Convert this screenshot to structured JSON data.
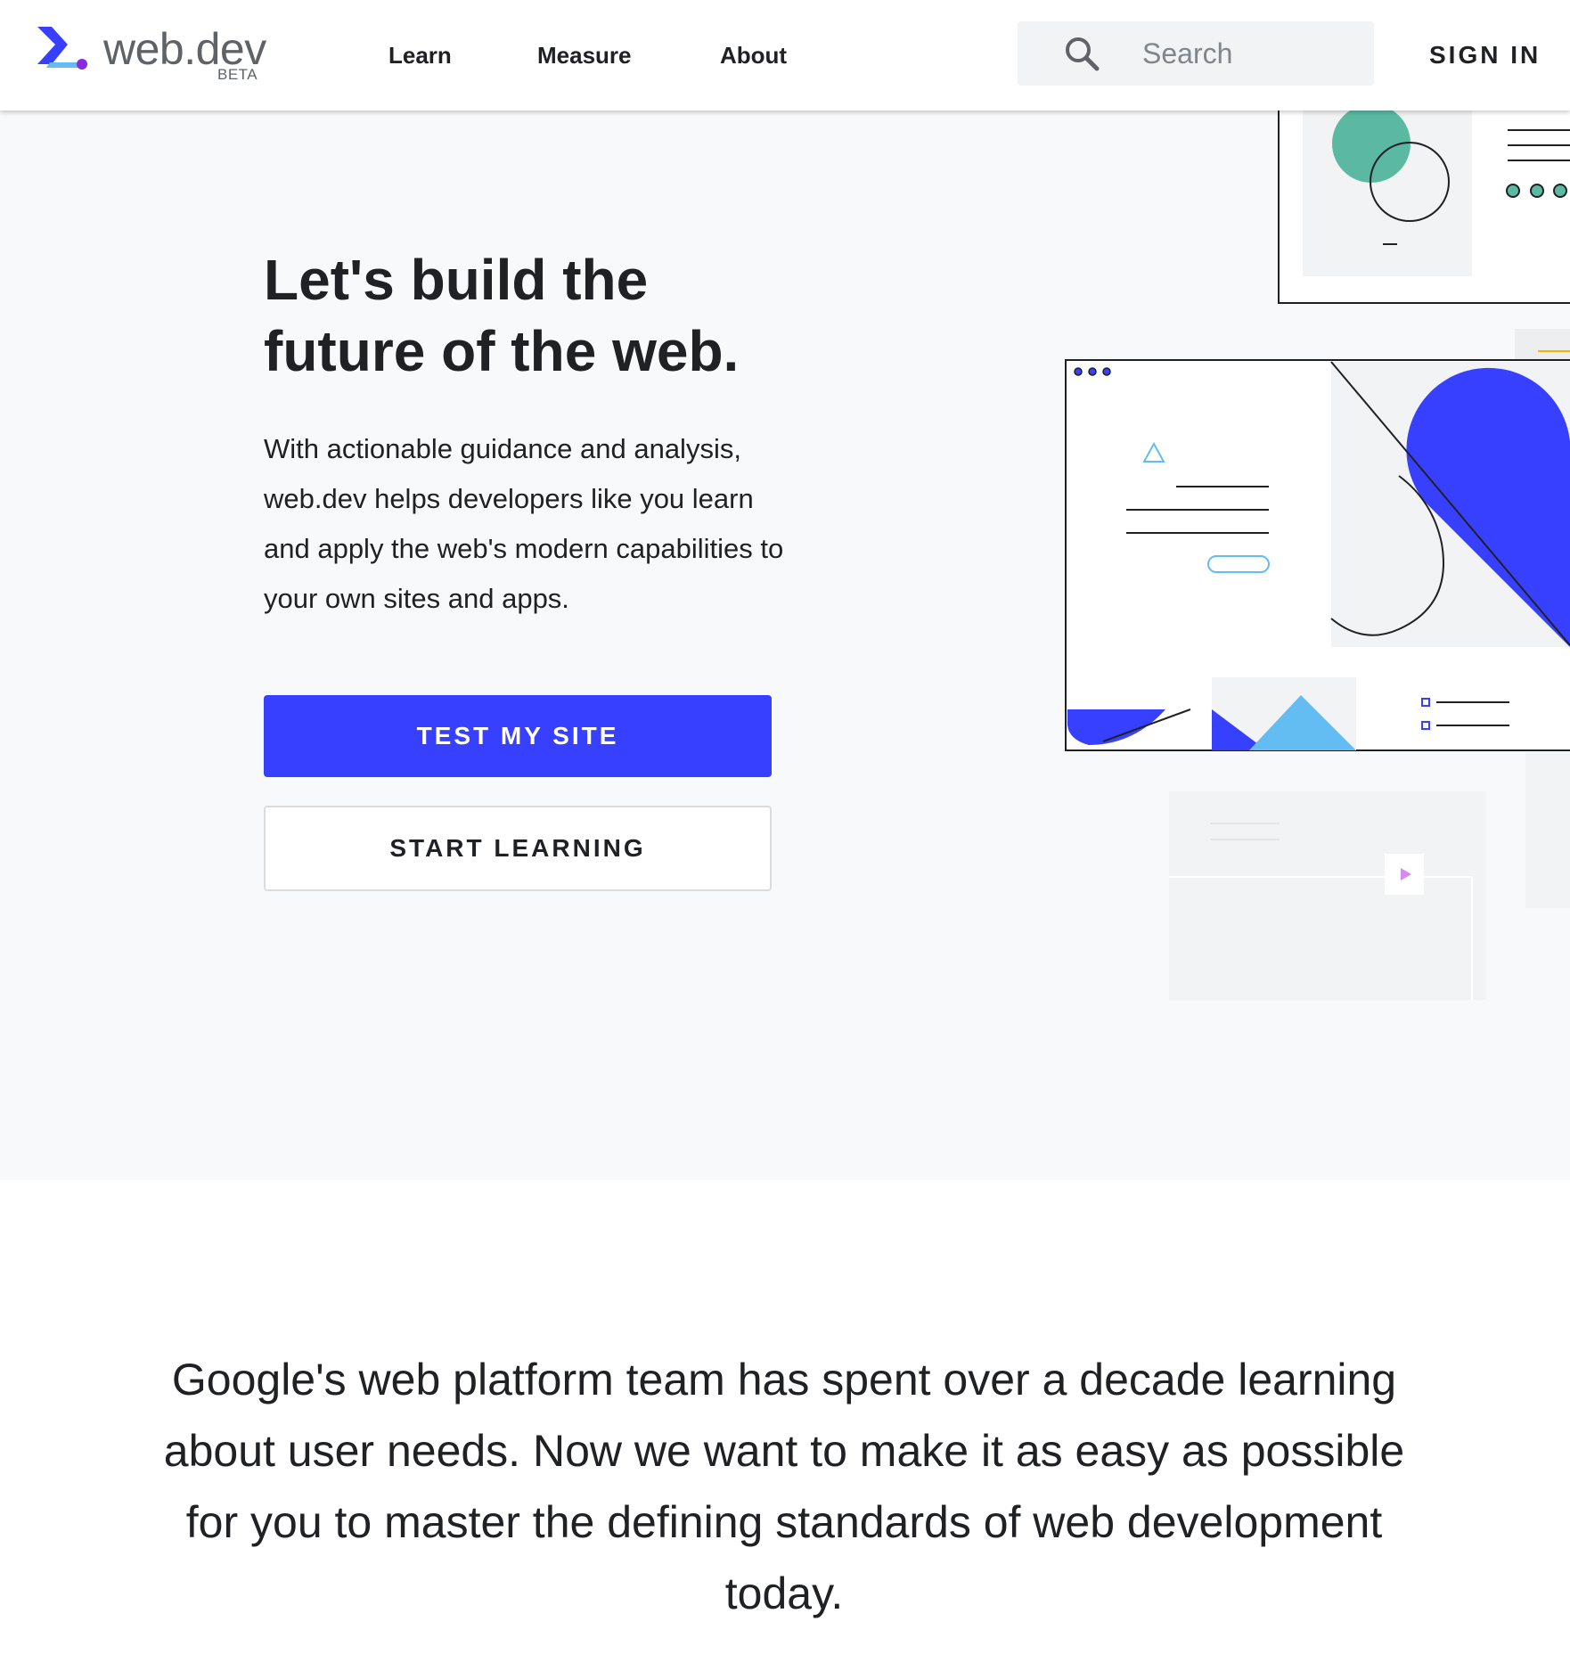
{
  "header": {
    "logo_text": "web.dev",
    "logo_badge": "BETA",
    "nav": {
      "learn": "Learn",
      "measure": "Measure",
      "about": "About"
    },
    "search_placeholder": "Search",
    "signin_label": "SIGN IN"
  },
  "hero": {
    "title_line1": "Let's build the",
    "title_line2": "future of the web.",
    "description": "With actionable guidance and analysis, web.dev helps developers like you learn and apply the web's modern capabilities to your own sites and apps.",
    "primary_button": "TEST MY SITE",
    "secondary_button": "START LEARNING"
  },
  "intro": {
    "text": "Google's web platform team has spent over a decade learning about user needs. Now we want to make it as easy as possible for you to master the defining standards of web development today."
  },
  "colors": {
    "brand_blue": "#3740ff",
    "hero_background": "#f8f9fa",
    "accent_green": "#5bb9a1",
    "accent_light_blue": "#63bcf2"
  },
  "icons": [
    "web-dev-logo-icon",
    "search-icon",
    "play-icon"
  ]
}
